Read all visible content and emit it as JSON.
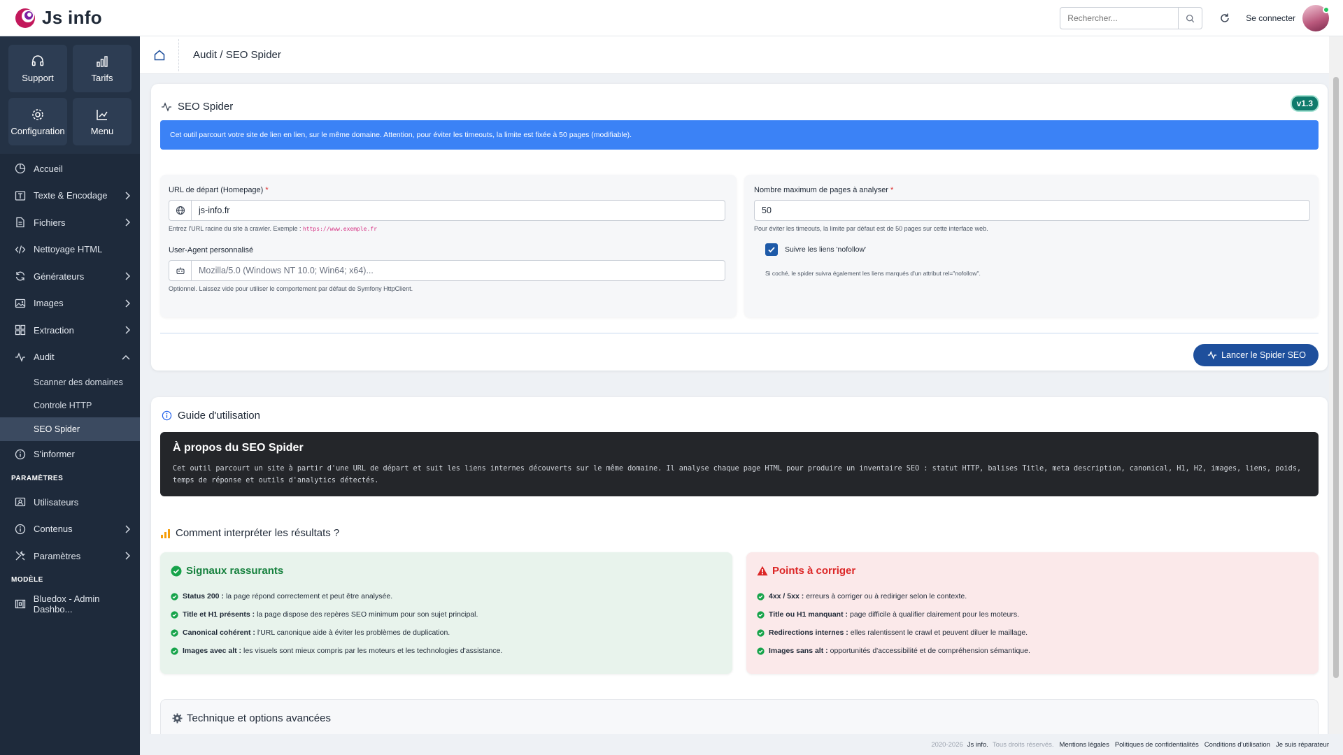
{
  "app": {
    "name": "Js info"
  },
  "topbar": {
    "search_placeholder": "Rechercher...",
    "login_label": "Se connecter"
  },
  "sidebar": {
    "quick": [
      {
        "label": "Support",
        "icon": "headset-icon"
      },
      {
        "label": "Tarifs",
        "icon": "bar-chart-icon"
      },
      {
        "label": "Configuration",
        "icon": "gear-icon"
      },
      {
        "label": "Menu",
        "icon": "trend-chart-icon"
      }
    ],
    "items": [
      {
        "label": "Accueil",
        "icon": "pie-chart-icon"
      },
      {
        "label": "Texte & Encodage",
        "icon": "text-icon"
      },
      {
        "label": "Fichiers",
        "icon": "file-icon"
      },
      {
        "label": "Nettoyage HTML",
        "icon": "code-icon"
      },
      {
        "label": "Générateurs",
        "icon": "refresh-icon"
      },
      {
        "label": "Images",
        "icon": "image-icon"
      },
      {
        "label": "Extraction",
        "icon": "grid-icon"
      },
      {
        "label": "Audit",
        "icon": "pulse-icon"
      }
    ],
    "audit_sub": [
      {
        "label": "Scanner des domaines"
      },
      {
        "label": "Controle HTTP"
      },
      {
        "label": "SEO Spider"
      }
    ],
    "informer": {
      "label": "S'informer",
      "icon": "info-icon"
    },
    "section_params": "PARAMÈTRES",
    "params_items": [
      {
        "label": "Utilisateurs",
        "icon": "user-card-icon"
      },
      {
        "label": "Contenus",
        "icon": "info-icon"
      },
      {
        "label": "Paramètres",
        "icon": "tools-icon"
      }
    ],
    "section_model": "MODÈLE",
    "model_item": {
      "label": "Bluedox - Admin Dashbo...",
      "icon": "template-icon"
    }
  },
  "breadcrumb": {
    "text": "Audit / SEO Spider"
  },
  "spider": {
    "title": "SEO Spider",
    "version": "v1.3",
    "banner": "Cet outil parcourt votre site de lien en lien, sur le même domaine. Attention, pour éviter les timeouts, la limite est fixée à 50 pages (modifiable).",
    "url_label": "URL de départ (Homepage)",
    "url_value": "js-info.fr",
    "url_help": "Entrez l'URL racine du site à crawler. Exemple :",
    "url_help_example": "https://www.exemple.fr",
    "ua_label": "User-Agent personnalisé",
    "ua_placeholder": "Mozilla/5.0 (Windows NT 10.0; Win64; x64)...",
    "ua_help": "Optionnel. Laissez vide pour utiliser le comportement par défaut de Symfony HttpClient.",
    "max_label": "Nombre maximum de pages à analyser",
    "max_value": "50",
    "max_help": "Pour éviter les timeouts, la limite par défaut est de 50 pages sur cette interface web.",
    "nofollow_label": "Suivre les liens 'nofollow'",
    "nofollow_checked": true,
    "nofollow_help": "Si coché, le spider suivra également les liens marqués d'un attribut rel=\"nofollow\".",
    "submit_label": "Lancer le Spider SEO"
  },
  "guide": {
    "title": "Guide d'utilisation",
    "about_title": "À propos du SEO Spider",
    "about_text": "Cet outil parcourt un site à partir d'une URL de départ et suit les liens internes découverts sur le même domaine. Il analyse chaque page HTML pour produire un inventaire SEO : statut HTTP, balises Title, meta description, canonical, H1, H2, images, liens, poids, temps de réponse et outils d'analytics détectés.",
    "interpret_title": "Comment interpréter les résultats ?",
    "good": {
      "title": "Signaux rassurants",
      "items": [
        {
          "bold": "Status 200 :",
          "text": "la page répond correctement et peut être analysée."
        },
        {
          "bold": "Title et H1 présents :",
          "text": "la page dispose des repères SEO minimum pour son sujet principal."
        },
        {
          "bold": "Canonical cohérent :",
          "text": "l'URL canonique aide à éviter les problèmes de duplication."
        },
        {
          "bold": "Images avec alt :",
          "text": "les visuels sont mieux compris par les moteurs et les technologies d'assistance."
        }
      ]
    },
    "bad": {
      "title": "Points à corriger",
      "items": [
        {
          "bold": "4xx / 5xx :",
          "text": "erreurs à corriger ou à rediriger selon le contexte."
        },
        {
          "bold": "Title ou H1 manquant :",
          "text": "page difficile à qualifier clairement pour les moteurs."
        },
        {
          "bold": "Redirections internes :",
          "text": "elles ralentissent le crawl et peuvent diluer le maillage."
        },
        {
          "bold": "Images sans alt :",
          "text": "opportunités d'accessibilité et de compréhension sémantique."
        }
      ]
    },
    "tech_title": "Technique et options avancées"
  },
  "footer": {
    "years": "2020-2026",
    "brand": "Js info.",
    "rights": "Tous droits réservés.",
    "links": [
      "Mentions légales",
      "Politiques de confidentialités",
      "Conditions d'utilisation",
      "Je suis réparateur"
    ]
  },
  "colors": {
    "sidebar_bg": "#1e2a3b",
    "banner_blue": "#3b82f6",
    "primary_button": "#1e4f9c",
    "success": "#15803d",
    "danger": "#dc2626",
    "version_badge": "#0f7b6c"
  }
}
